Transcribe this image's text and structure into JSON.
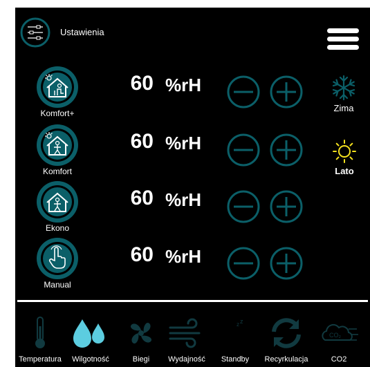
{
  "header": {
    "settings_label": "Ustawienia",
    "settings_icon": "sliders-icon",
    "menu_icon": "hamburger-menu-icon"
  },
  "modes": [
    {
      "label": "Komfort+",
      "humidity": "60",
      "unit": "%rH",
      "icon": "house-sun-person-sitting-icon"
    },
    {
      "label": "Komfort",
      "humidity": "60",
      "unit": "%rH",
      "icon": "house-sun-person-icon"
    },
    {
      "label": "Ekono",
      "humidity": "60",
      "unit": "%rH",
      "icon": "house-moon-person-icon"
    },
    {
      "label": "Manual",
      "humidity": "60",
      "unit": "%rH",
      "icon": "hand-pointer-icon"
    }
  ],
  "seasons": [
    {
      "label": "Zima",
      "icon": "snowflake-icon"
    },
    {
      "label": "Lato",
      "icon": "sun-icon"
    }
  ],
  "nav": [
    {
      "label": "Temperatura",
      "icon": "thermometer-icon"
    },
    {
      "label": "Wilgotność",
      "icon": "water-drops-icon"
    },
    {
      "label": "Biegi",
      "icon": "fan-icon"
    },
    {
      "label": "Wydajność",
      "icon": "wind-icon"
    },
    {
      "label": "Standby",
      "icon": "moon-zzz-icon"
    },
    {
      "label": "Recyrkulacja",
      "icon": "recirculation-icon"
    },
    {
      "label": "CO2",
      "icon": "co2-cloud-icon"
    }
  ],
  "colors": {
    "accent": "#0b5f68",
    "active": "#5ccde0",
    "dim": "#113a40",
    "background": "#000000",
    "text": "#ffffff"
  }
}
